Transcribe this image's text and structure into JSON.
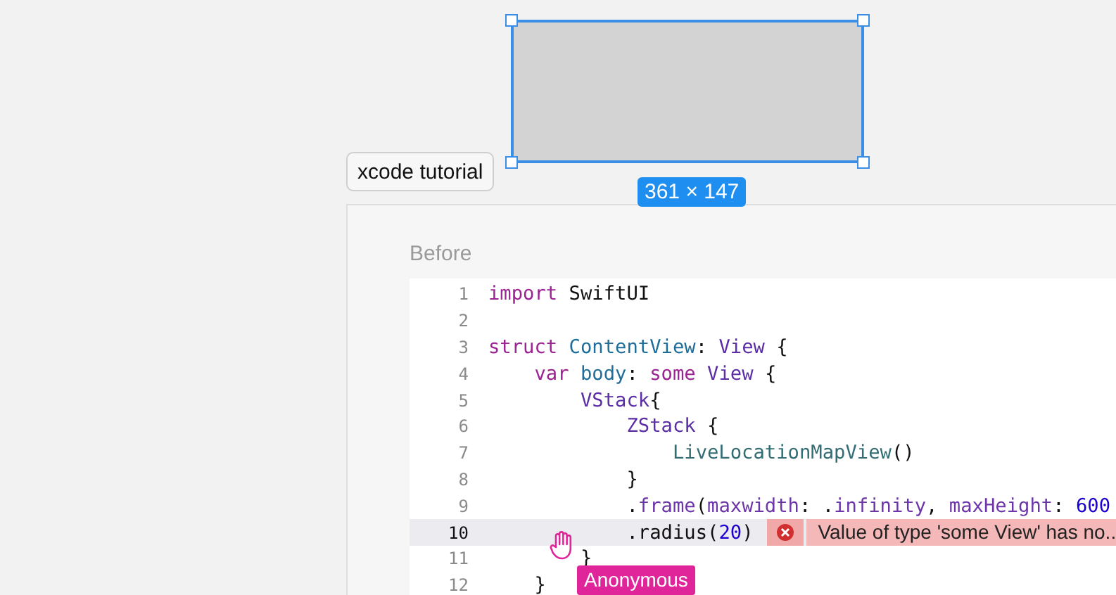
{
  "canvas": {
    "frame_label": "xcode tutorial",
    "selection": {
      "size_label": "361 × 147"
    }
  },
  "panel": {
    "title": "Before",
    "code_lines": [
      {
        "number": "1",
        "highlighted": false,
        "tokens": [
          {
            "kind": "keyword",
            "text": "import"
          },
          {
            "kind": "plain",
            "text": " SwiftUI"
          }
        ]
      },
      {
        "number": "2",
        "highlighted": false
      },
      {
        "number": "3",
        "highlighted": false,
        "tokens": [
          {
            "kind": "keyword",
            "text": "struct"
          },
          {
            "kind": "decl",
            "text": " ContentView"
          },
          {
            "kind": "plain",
            "text": ": "
          },
          {
            "kind": "type",
            "text": "View"
          },
          {
            "kind": "plain",
            "text": " {"
          }
        ]
      },
      {
        "number": "4",
        "highlighted": false,
        "tokens": [
          {
            "kind": "keyword",
            "text": "    var"
          },
          {
            "kind": "decl",
            "text": " body"
          },
          {
            "kind": "plain",
            "text": ": "
          },
          {
            "kind": "keyword",
            "text": "some"
          },
          {
            "kind": "type",
            "text": " View"
          },
          {
            "kind": "plain",
            "text": " {"
          }
        ]
      },
      {
        "number": "5",
        "highlighted": false,
        "tokens": [
          {
            "kind": "type",
            "text": "        VStack"
          },
          {
            "kind": "plain",
            "text": "{"
          }
        ]
      },
      {
        "number": "6",
        "highlighted": false,
        "tokens": [
          {
            "kind": "type",
            "text": "            ZStack"
          },
          {
            "kind": "plain",
            "text": " {"
          }
        ]
      },
      {
        "number": "7",
        "highlighted": false,
        "tokens": [
          {
            "kind": "project",
            "text": "                LiveLocationMapView"
          },
          {
            "kind": "plain",
            "text": "()"
          }
        ]
      },
      {
        "number": "8",
        "highlighted": false,
        "tokens": [
          {
            "kind": "plain",
            "text": "            }"
          }
        ]
      },
      {
        "number": "9",
        "highlighted": false,
        "tokens": [
          {
            "kind": "plain",
            "text": "            ."
          },
          {
            "kind": "member",
            "text": "frame"
          },
          {
            "kind": "plain",
            "text": "("
          },
          {
            "kind": "member",
            "text": "maxwidth"
          },
          {
            "kind": "plain",
            "text": ": ."
          },
          {
            "kind": "member",
            "text": "infinity"
          },
          {
            "kind": "plain",
            "text": ", "
          },
          {
            "kind": "member",
            "text": "maxHeight"
          },
          {
            "kind": "plain",
            "text": ": "
          },
          {
            "kind": "number",
            "text": "600"
          }
        ]
      },
      {
        "number": "10",
        "highlighted": true,
        "error": "Value of type 'some View' has no...",
        "tokens": [
          {
            "kind": "plain",
            "text": "            .radius("
          },
          {
            "kind": "number",
            "text": "20"
          },
          {
            "kind": "plain",
            "text": ")"
          }
        ]
      },
      {
        "number": "11",
        "highlighted": false,
        "tokens": [
          {
            "kind": "plain",
            "text": "        }"
          }
        ]
      },
      {
        "number": "12",
        "highlighted": false,
        "tokens": [
          {
            "kind": "plain",
            "text": "    }"
          }
        ]
      }
    ],
    "cursor": {
      "label": "Anonymous"
    }
  }
}
